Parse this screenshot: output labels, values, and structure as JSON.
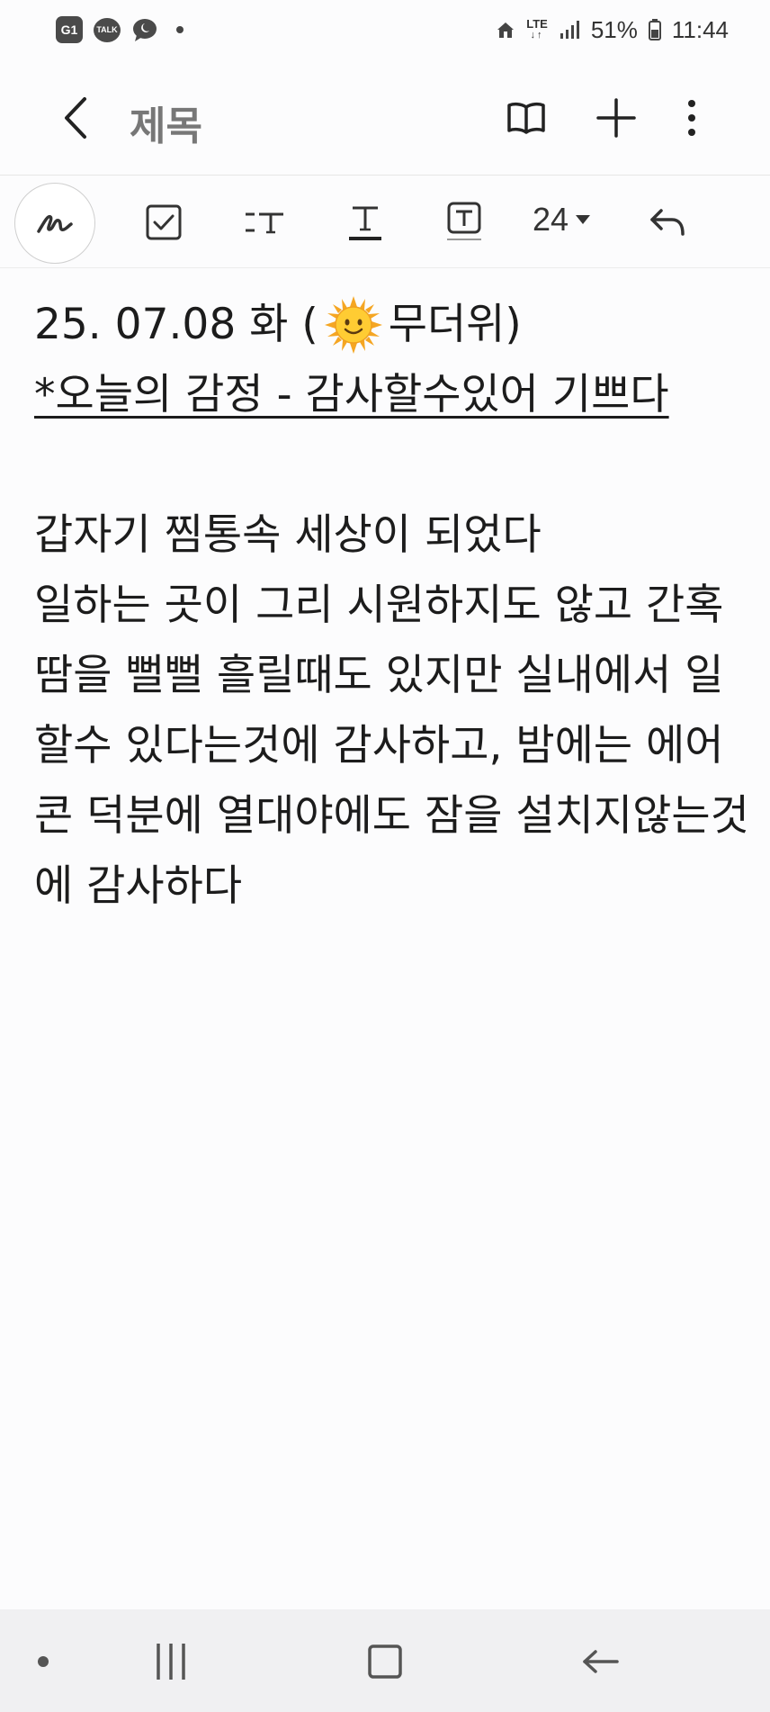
{
  "status_bar": {
    "notif1": "G1",
    "notif2": "TALK",
    "network": "LTE",
    "battery": "51%",
    "time": "11:44"
  },
  "title_bar": {
    "title": "제목",
    "icons": [
      "back-icon",
      "reading-mode-icon",
      "add-icon",
      "more-icon"
    ]
  },
  "toolbar": {
    "font_size": "24",
    "icons": [
      "pen-icon",
      "checkbox-icon",
      "text-style-icon",
      "text-underline-icon",
      "text-box-icon",
      "undo-icon"
    ]
  },
  "note": {
    "date_prefix": "25. 07.08 화 (",
    "date_suffix": "무더위)",
    "emotion_line": "*오늘의 감정 - 감사할수있어 기쁘다",
    "body_lines": [
      "갑자기 찜통속 세상이 되었다",
      "일하는 곳이 그리 시원하지도 않고 간혹",
      "땀을 뻘뻘 흘릴때도 있지만 실내에서 일",
      "할수 있다는것에 감사하고, 밤에는 에어",
      "콘 덕분에 열대야에도 잠을 설치지않는것",
      "에 감사하다"
    ]
  },
  "nav_bar": {
    "icons": [
      "dot-icon",
      "recent-apps-icon",
      "home-icon",
      "back-nav-icon"
    ]
  }
}
